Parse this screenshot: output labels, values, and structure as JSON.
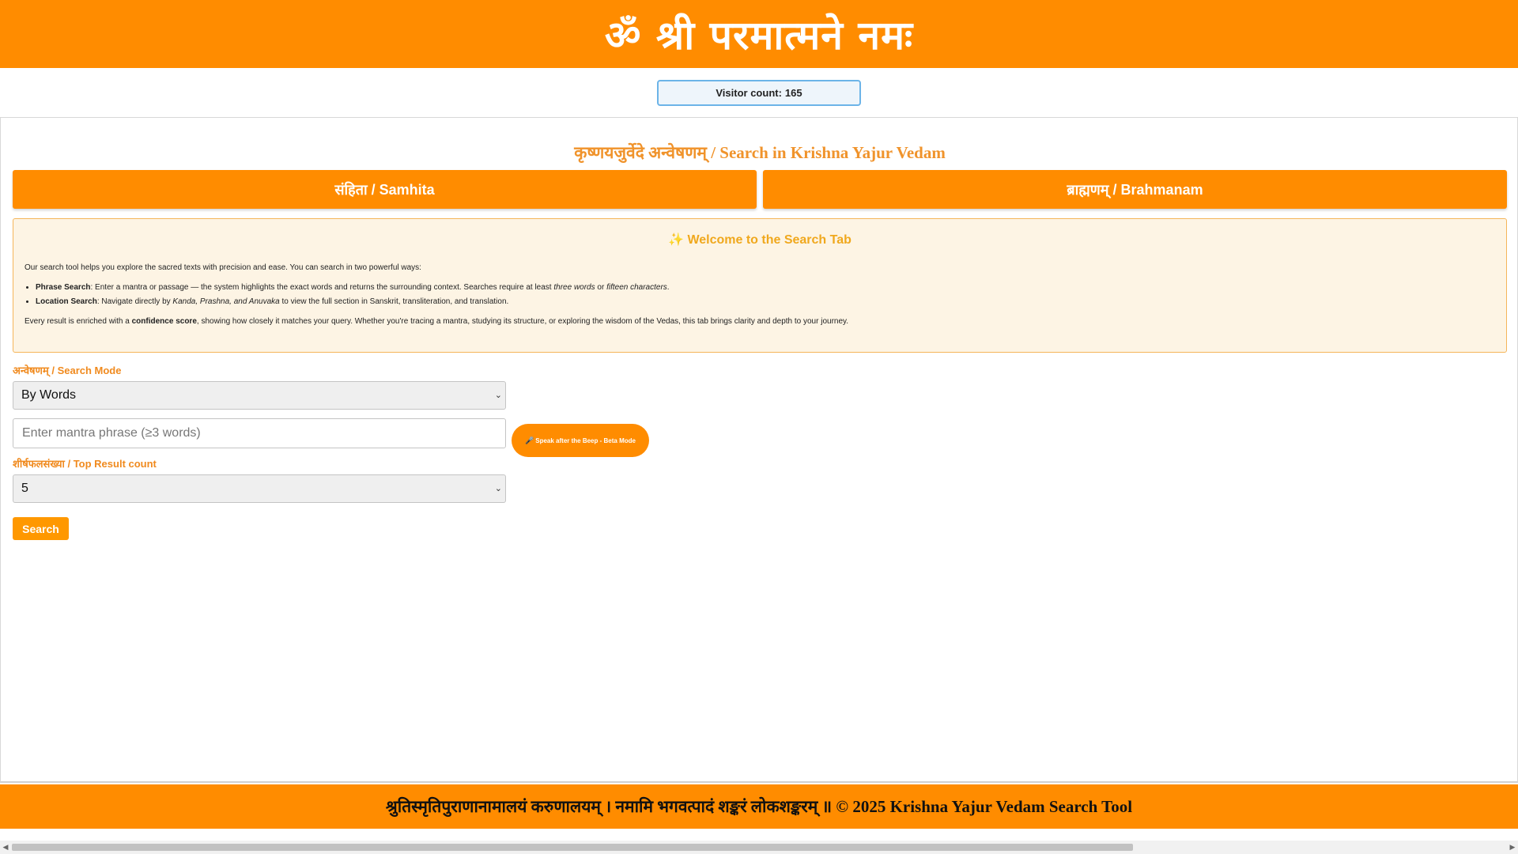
{
  "header": {
    "title": "ॐ श्री परमात्मने नमः"
  },
  "visitor": {
    "label": "Visitor count:",
    "count": "165"
  },
  "main": {
    "heading": "कृष्णयजुर्वेदे अन्वेषणम् / Search in Krishna Yajur Vedam",
    "tabs": [
      {
        "label": "संहिता / Samhita"
      },
      {
        "label": "ब्राह्मणम् / Brahmanam"
      }
    ],
    "welcome": {
      "title": "✨ Welcome to the Search Tab",
      "intro": "Our search tool helps you explore the sacred texts with precision and ease. You can search in two powerful ways:",
      "items": [
        {
          "term": "Phrase Search",
          "text_a": ": Enter a mantra or passage — the system highlights the exact words and returns the surrounding context. Searches require at least ",
          "em_1": "three words",
          "text_b": " or ",
          "em_2": "fifteen characters",
          "text_c": "."
        },
        {
          "term": "Location Search",
          "text_a": ": Navigate directly by ",
          "em_1": "Kanda, Prashna, and Anuvaka",
          "text_b": " to view the full section in Sanskrit, transliteration, and translation."
        }
      ],
      "foot_a": "Every result is enriched with a ",
      "foot_strong": "confidence score",
      "foot_b": ", showing how closely it matches your query. Whether you're tracing a mantra, studying its structure, or exploring the wisdom of the Vedas, this tab brings clarity and depth to your journey."
    },
    "search_mode": {
      "label": "अन्वेषणम् / Search Mode",
      "selected": "By Words"
    },
    "phrase_input": {
      "value": "",
      "placeholder": "Enter mantra phrase (≥3 words)"
    },
    "speak_button": {
      "icon": "microphone-icon",
      "glyph": "🎤",
      "label": "Speak after the Beep - Beta Mode"
    },
    "result_count": {
      "label": "शीर्षफलसंख्या / Top Result count",
      "selected": "5"
    },
    "search_button": {
      "label": "Search"
    }
  },
  "footer": {
    "text": "श्रुतिस्मृतिपुराणानामालयं करुणालयम् । नमामि भगवत्पादं शङ्करं लोकशङ्करम् ॥ © 2025 Krishna Yajur Vedam Search Tool"
  },
  "colors": {
    "brand_orange": "#ff8c00",
    "heading_orange": "#f0932b",
    "welcome_bg": "#fdf4e4",
    "visitor_border": "#6cb4e8"
  }
}
